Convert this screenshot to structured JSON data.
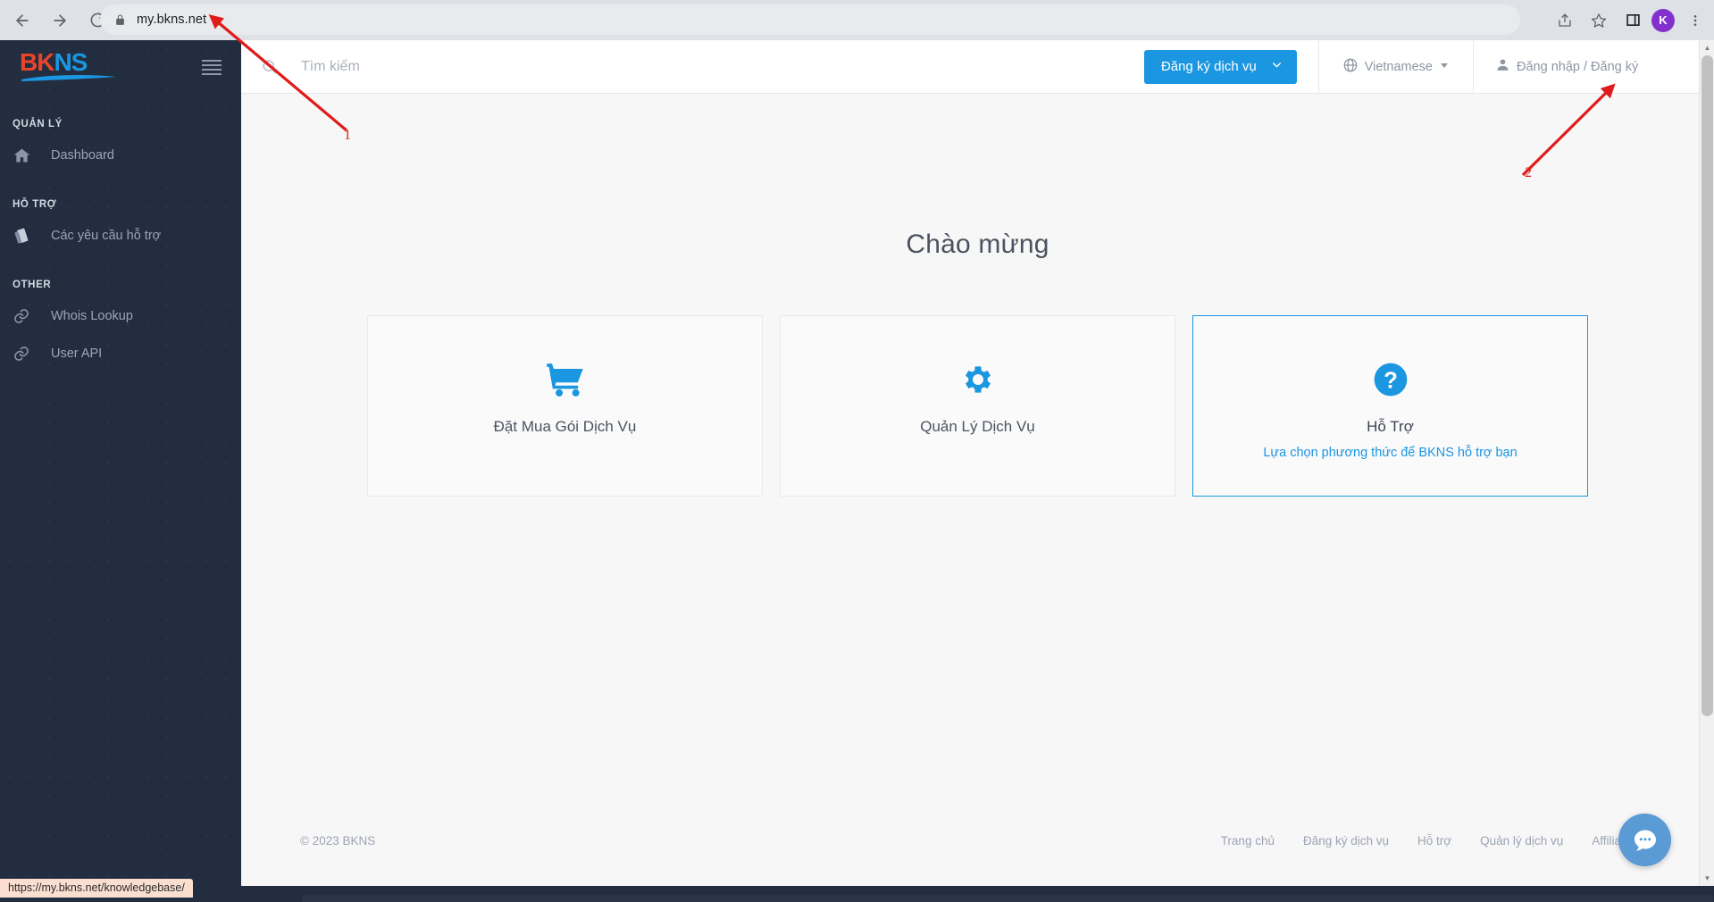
{
  "browser": {
    "url": "my.bkns.net",
    "back_title": "Back",
    "forward_title": "Forward",
    "reload_title": "Reload",
    "lock_icon": "lock-icon",
    "share_icon": "share-icon",
    "bookmark_icon": "star-icon",
    "side_panel_icon": "side-panel-icon",
    "profile_initial": "K",
    "menu_icon": "three-dots-icon",
    "status_url": "https://my.bkns.net/knowledgebase/"
  },
  "sidebar": {
    "logo": {
      "first": "BK",
      "second": "NS"
    },
    "hamburger_name": "hamburger-icon",
    "sections": [
      {
        "title": "QUẢN LÝ",
        "items": [
          {
            "label": "Dashboard",
            "icon": "home-icon"
          }
        ]
      },
      {
        "title": "HỖ TRỢ",
        "items": [
          {
            "label": "Các yêu cầu hỗ trợ",
            "icon": "tickets-icon"
          }
        ]
      },
      {
        "title": "OTHER",
        "items": [
          {
            "label": "Whois Lookup",
            "icon": "link-icon"
          },
          {
            "label": "User API",
            "icon": "link-icon"
          }
        ]
      }
    ]
  },
  "topbar": {
    "search_placeholder": "Tìm kiếm",
    "search_value": "",
    "search_icon": "search-icon",
    "register_button": "Đăng ký dịch vụ",
    "register_caret": "chevron-down-icon",
    "language": "Vietnamese",
    "language_icon": "globe-icon",
    "language_caret": "chevron-down-icon",
    "login": "Đăng nhập / Đăng ký",
    "login_icon": "user-icon"
  },
  "main": {
    "title": "Chào mừng",
    "cards": [
      {
        "title": "Đặt Mua Gói Dịch Vụ",
        "subtitle": "",
        "icon": "shopping-cart-icon",
        "active": false
      },
      {
        "title": "Quản Lý Dịch Vụ",
        "subtitle": "",
        "icon": "gear-icon",
        "active": false
      },
      {
        "title": "Hỗ Trợ",
        "subtitle": "Lựa chọn phương thức để BKNS hỗ trợ bạn",
        "icon": "question-mark-icon",
        "active": true
      }
    ]
  },
  "footer": {
    "copyright": "© 2023 BKNS",
    "links": [
      "Trang chủ",
      "Đăng ký dịch vụ",
      "Hỗ trợ",
      "Quản lý dịch vụ",
      "Affiliates"
    ]
  },
  "chat": {
    "icon": "chat-bubble-icon"
  },
  "annotations": [
    {
      "label": "1"
    },
    {
      "label": "2"
    }
  ],
  "colors": {
    "accent": "#1b96e0",
    "sidebar_bg": "#222e3f",
    "content_bg": "#f7f7f7",
    "annotation_red": "#e01b1b",
    "logo_red": "#e8452c",
    "avatar_purple": "#8430ce"
  }
}
